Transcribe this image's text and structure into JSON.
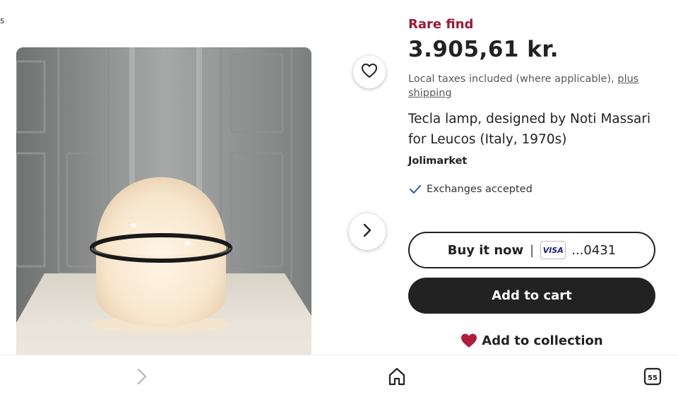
{
  "edge": {
    "glyph": "s"
  },
  "product": {
    "badge": "Rare find",
    "price": "3.905,61 kr.",
    "taxes_text": "Local taxes included (where applicable),",
    "shipping_link": "plus shipping",
    "title": "Tecla lamp, designed by Noti Massari for Leucos (Italy, 1970s)",
    "shop_name": "Jolimarket",
    "exchanges": "Exchanges accepted"
  },
  "actions": {
    "buy_now_label": "Buy it now",
    "buy_now_separator": "|",
    "card_brand": "VISA",
    "card_suffix": "...0431",
    "add_to_cart": "Add to cart",
    "add_to_collection": "Add to collection"
  },
  "bottom_nav": {
    "tab_count": "55"
  },
  "colors": {
    "badge": "#9b1b37",
    "primary_button": "#222222",
    "heart": "#b01e3c",
    "check": "#2a5fb0"
  },
  "icons": {
    "favorite": "heart-outline-icon",
    "next": "chevron-right-icon",
    "back": "chevron-right-icon",
    "home": "home-icon",
    "tabs": "tabs-count-icon",
    "collection": "heart-filled-icon",
    "exchanges": "check-icon"
  }
}
